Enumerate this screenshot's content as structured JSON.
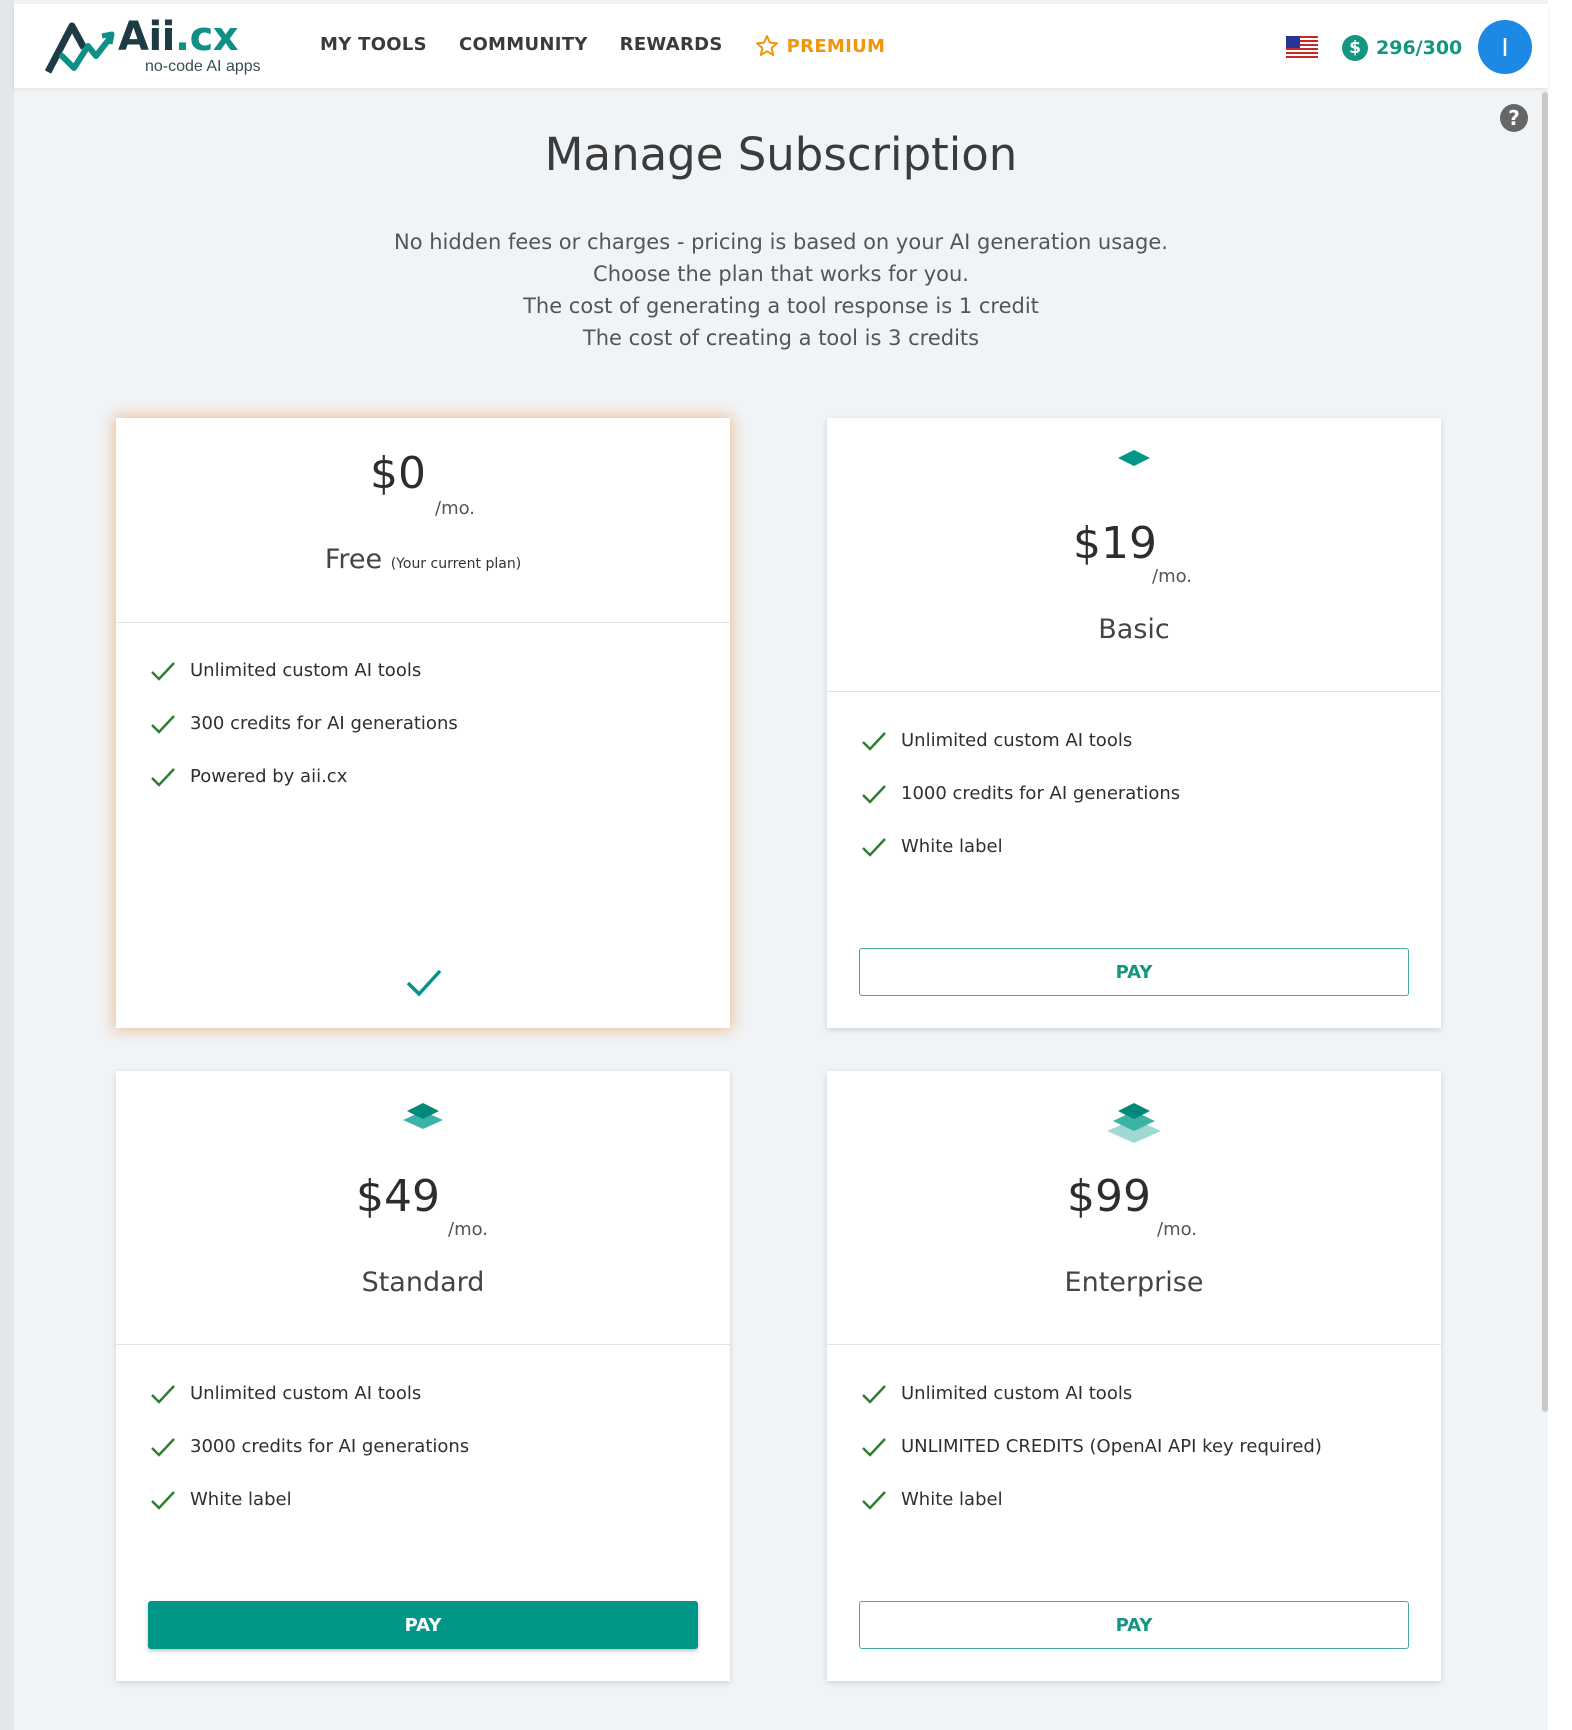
{
  "header": {
    "logo_name": "Aii",
    "logo_ext": ".cx",
    "logo_sub": "no-code AI apps",
    "nav": [
      "MY TOOLS",
      "COMMUNITY",
      "REWARDS"
    ],
    "premium_label": "PREMIUM",
    "credits": "296/300",
    "credits_symbol": "$",
    "avatar_initial": "I",
    "help_symbol": "?"
  },
  "page": {
    "title": "Manage Subscription",
    "intro": [
      "No hidden fees or charges - pricing is based on your AI generation usage.",
      "Choose the plan that works for you.",
      "The cost of generating a tool response is 1 credit",
      "The cost of creating a tool is 3 credits"
    ]
  },
  "plans": [
    {
      "price": "$0",
      "per": "/mo.",
      "name": "Free",
      "current_note": "(Your current plan)",
      "features": [
        "Unlimited custom AI tools",
        "300 credits for AI generations",
        "Powered by aii.cx"
      ],
      "current": true
    },
    {
      "price": "$19",
      "per": "/mo.",
      "name": "Basic",
      "features": [
        "Unlimited custom AI tools",
        "1000 credits for AI generations",
        "White label"
      ],
      "button": "PAY",
      "icon": "single-layer-icon"
    },
    {
      "price": "$49",
      "per": "/mo.",
      "name": "Standard",
      "features": [
        "Unlimited custom AI tools",
        "3000 credits for AI generations",
        "White label"
      ],
      "button": "PAY",
      "icon": "double-layer-icon"
    },
    {
      "price": "$99",
      "per": "/mo.",
      "name": "Enterprise",
      "features": [
        "Unlimited custom AI tools",
        "UNLIMITED CREDITS (OpenAI API key required)",
        "White label"
      ],
      "button": "PAY",
      "icon": "triple-layer-icon"
    }
  ],
  "colors": {
    "accent": "#009688",
    "premium": "#f0950c",
    "avatar": "#1e88e5",
    "check": "#2e7d32"
  }
}
